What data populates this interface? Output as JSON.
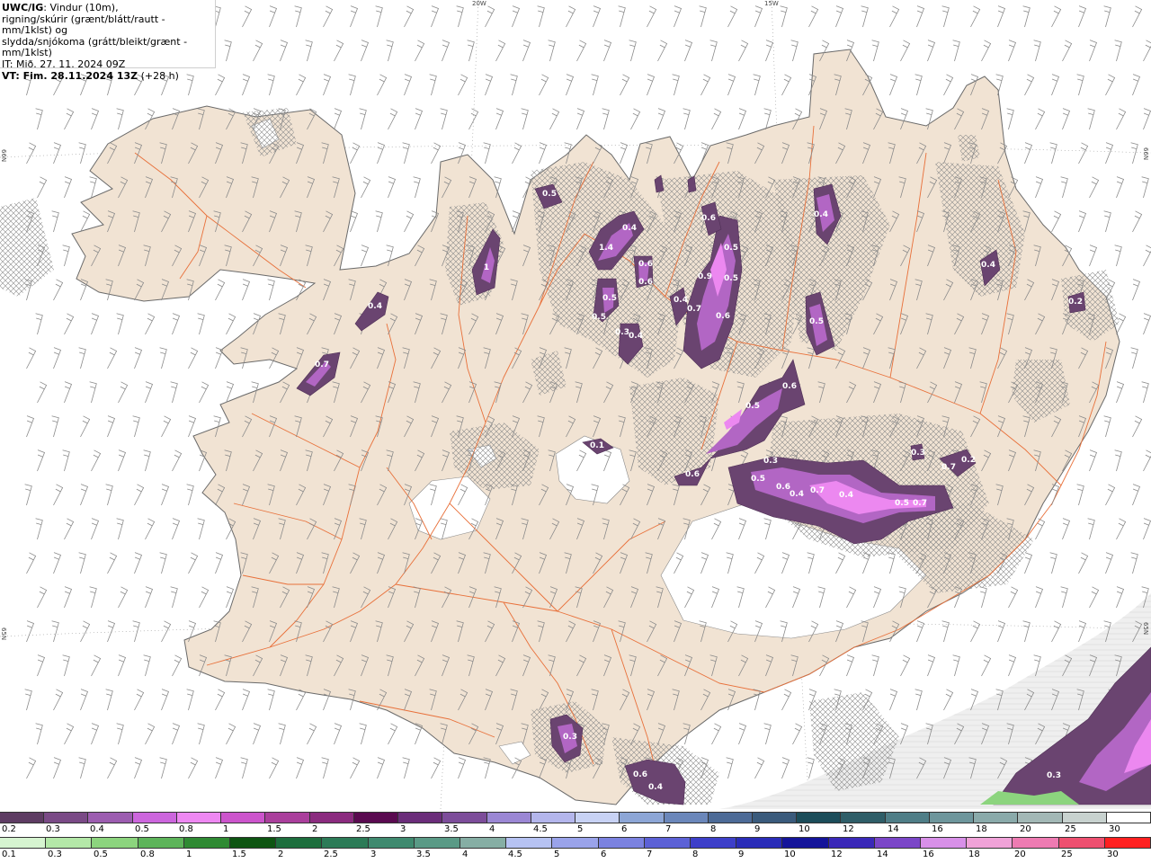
{
  "info": {
    "model": "UWC/IG",
    "line1_rest": ": Vindur (10m),",
    "line2": "rigning/skúrir (grænt/blátt/rautt - mm/1klst) og",
    "line3": "slydda/snjókoma (grátt/bleikt/grænt - mm/1klst)",
    "it": "IT: Mið. 27. 11. 2024 09Z",
    "vt_label": "VT: Fim. 28.11.2024 13Z",
    "vt_rest": " (+28 h)"
  },
  "graticule": {
    "lon_labels": [
      "20W",
      "15W"
    ],
    "lat_labels": [
      "66N",
      "65N"
    ]
  },
  "precip_labels": [
    "0.5",
    "0.4",
    "1.4",
    "0.6",
    "0.6",
    "1",
    "0.4",
    "0.7",
    "0.5",
    "0.5",
    "0.3",
    "0.4",
    "0.6",
    "0.4",
    "0.7",
    "0.6",
    "0.9",
    "0.5",
    "0.5",
    "0.6",
    "0.5",
    "0.5",
    "0.4",
    "0.6",
    "0.5",
    "0.6",
    "0.3",
    "0.4",
    "0.7",
    "0.4",
    "0.5",
    "0.7",
    "0.7",
    "0.2",
    "0.3",
    "0.1",
    "0.3",
    "0.6",
    "0.4",
    "0.4",
    "0.3",
    "0.2"
  ],
  "legend_snow": {
    "labels": [
      "0.2",
      "0.3",
      "0.4",
      "0.5",
      "0.8",
      "1",
      "1.5",
      "2",
      "2.5",
      "3",
      "3.5",
      "4",
      "4.5",
      "5",
      "6",
      "7",
      "8",
      "9",
      "10",
      "12",
      "14",
      "16",
      "18",
      "20",
      "25",
      "30"
    ],
    "colors": [
      "#5e3c63",
      "#7a4a86",
      "#9c5db0",
      "#cc66dd",
      "#ee88f2",
      "#cc55cc",
      "#aa3f9c",
      "#8b2b7f",
      "#5a0a50",
      "#6b2d7a",
      "#7d4d9a",
      "#9b87d4",
      "#b4b6ec",
      "#c8d2f4",
      "#8da6d6",
      "#6b87ba",
      "#4d6b97",
      "#3b5b7c",
      "#1c4d5a",
      "#2f5e68",
      "#4f7e87",
      "#6e969c",
      "#8aaaaa",
      "#a3b8b6",
      "#c8d2cf",
      "#ffffff"
    ]
  },
  "legend_rain": {
    "labels": [
      "0.1",
      "0.3",
      "0.5",
      "0.8",
      "1",
      "1.5",
      "2",
      "2.5",
      "3",
      "3.5",
      "4",
      "4.5",
      "5",
      "6",
      "7",
      "8",
      "9",
      "10",
      "12",
      "14",
      "16",
      "18",
      "20",
      "25",
      "30"
    ],
    "colors": [
      "#d6f4d0",
      "#b4e8a8",
      "#8cd47e",
      "#5db45a",
      "#2f8a33",
      "#0e5512",
      "#1d6e3d",
      "#2c7b57",
      "#3f8a6f",
      "#5a9a86",
      "#86aea4",
      "#b6c2f2",
      "#9aa3ea",
      "#7b82e0",
      "#5c61d6",
      "#3d3fc9",
      "#2a2cb8",
      "#14149a",
      "#3a28b8",
      "#7b46c8",
      "#d890e8",
      "#f0a2d8",
      "#ee7bb2",
      "#ee5070",
      "#ff2020"
    ]
  },
  "colors": {
    "land": "#f1e3d3",
    "sea": "#ffffff",
    "roads": "#e8703a",
    "barbs": "#8a8a8a",
    "hatch": "#8c8c8c",
    "glacier": "#ffffff"
  }
}
